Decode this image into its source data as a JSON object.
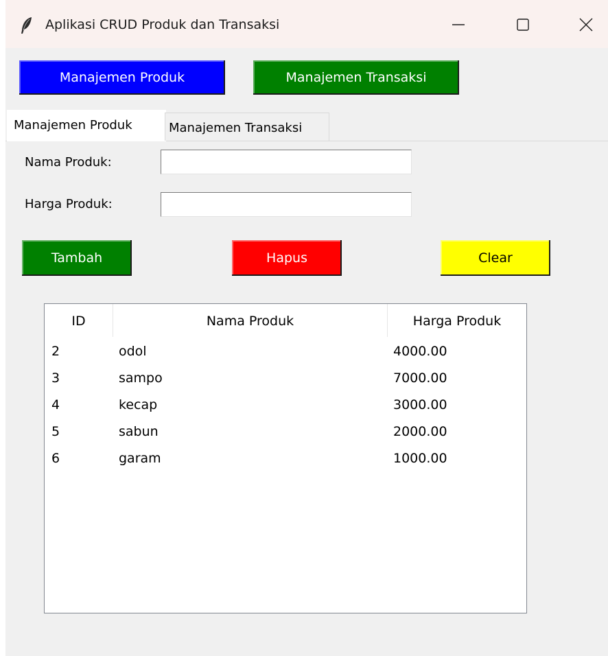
{
  "window": {
    "title": "Aplikasi CRUD Produk dan Transaksi",
    "icon": "feather-icon"
  },
  "toolbar": {
    "produk_label": "Manajemen Produk",
    "transaksi_label": "Manajemen Transaksi",
    "produk_color": "#0000ff",
    "transaksi_color": "#008000"
  },
  "tabs": [
    {
      "label": "Manajemen Produk",
      "selected": true
    },
    {
      "label": "Manajemen Transaksi",
      "selected": false
    }
  ],
  "form": {
    "nama_label": "Nama Produk:",
    "nama_value": "",
    "harga_label": "Harga Produk:",
    "harga_value": ""
  },
  "actions": {
    "tambah_label": "Tambah",
    "hapus_label": "Hapus",
    "clear_label": "Clear",
    "tambah_color": "#008000",
    "hapus_color": "#ff0000",
    "clear_color": "#ffff00"
  },
  "table": {
    "columns": [
      "ID",
      "Nama Produk",
      "Harga Produk"
    ],
    "rows": [
      {
        "id": "2",
        "nama": "odol",
        "harga": "4000.00"
      },
      {
        "id": "3",
        "nama": "sampo",
        "harga": "7000.00"
      },
      {
        "id": "4",
        "nama": "kecap",
        "harga": "3000.00"
      },
      {
        "id": "5",
        "nama": "sabun",
        "harga": "2000.00"
      },
      {
        "id": "6",
        "nama": "garam",
        "harga": "1000.00"
      }
    ]
  }
}
